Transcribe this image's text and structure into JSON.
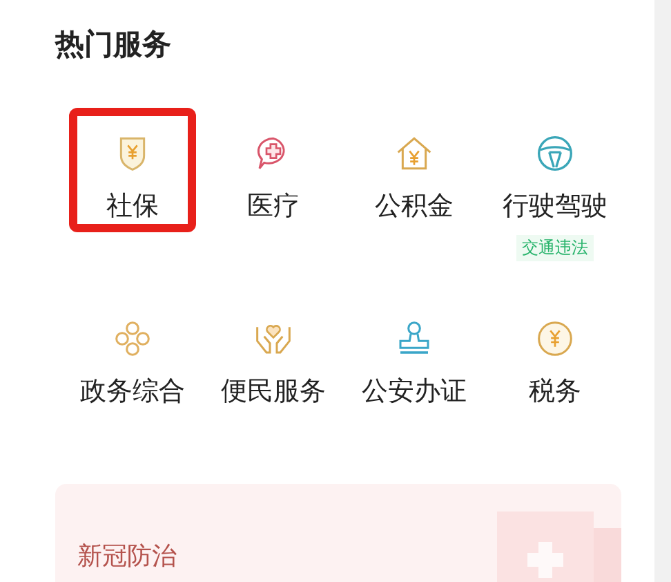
{
  "section_title": "热门服务",
  "services": [
    {
      "label": "社保",
      "highlighted": true
    },
    {
      "label": "医疗",
      "highlighted": false
    },
    {
      "label": "公积金",
      "highlighted": false
    },
    {
      "label": "行驶驾驶",
      "highlighted": false,
      "tag": "交通违法"
    },
    {
      "label": "政务综合",
      "highlighted": false
    },
    {
      "label": "便民服务",
      "highlighted": false
    },
    {
      "label": "公安办证",
      "highlighted": false
    },
    {
      "label": "税务",
      "highlighted": false
    }
  ],
  "banner": {
    "title": "新冠防治"
  }
}
